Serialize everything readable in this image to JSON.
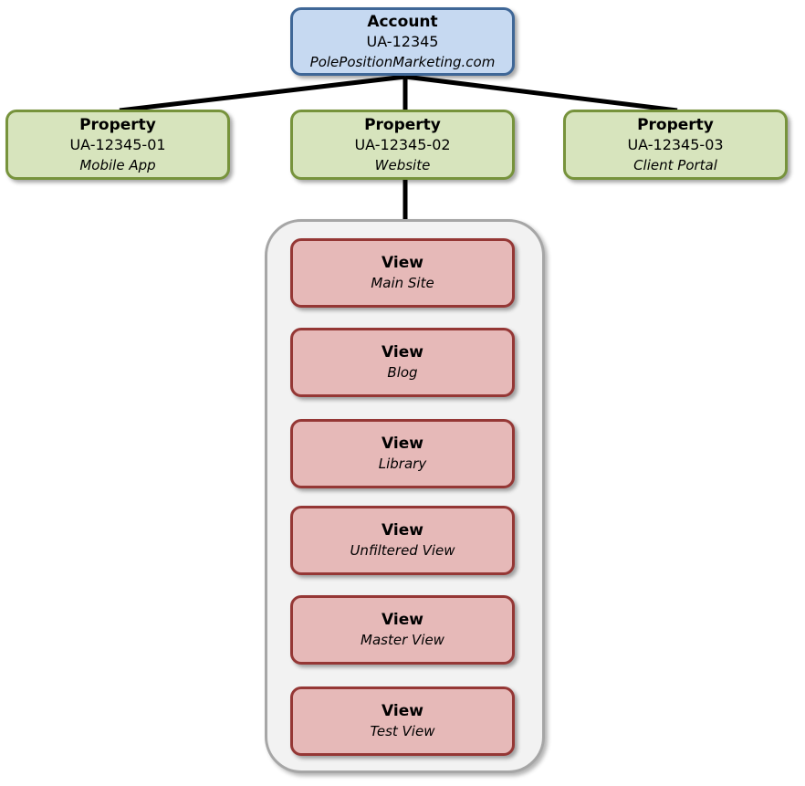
{
  "account": {
    "title": "Account",
    "id": "UA-12345",
    "name": "PolePositionMarketing.com"
  },
  "properties": [
    {
      "title": "Property",
      "id": "UA-12345-01",
      "name": "Mobile App"
    },
    {
      "title": "Property",
      "id": "UA-12345-02",
      "name": "Website"
    },
    {
      "title": "Property",
      "id": "UA-12345-03",
      "name": "Client Portal"
    }
  ],
  "views": [
    {
      "title": "View",
      "name": "Main Site"
    },
    {
      "title": "View",
      "name": "Blog"
    },
    {
      "title": "View",
      "name": "Library"
    },
    {
      "title": "View",
      "name": "Unfiltered View"
    },
    {
      "title": "View",
      "name": "Master View"
    },
    {
      "title": "View",
      "name": "Test View"
    }
  ],
  "colors": {
    "account_fill": "#c6d9f1",
    "account_border": "#3f6797",
    "property_fill": "#d7e4bd",
    "property_border": "#77933c",
    "view_fill": "#e6b9b8",
    "view_border": "#953735"
  }
}
